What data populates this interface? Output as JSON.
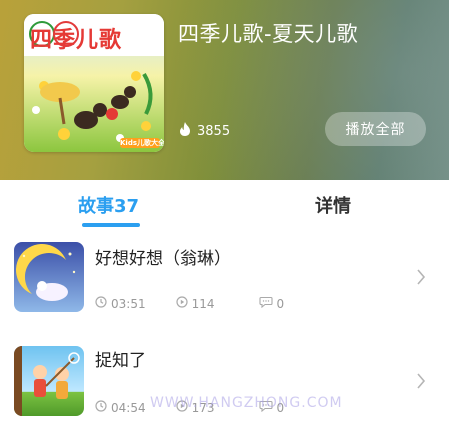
{
  "album": {
    "title": "四季儿歌-夏天儿歌",
    "play_count": "3855",
    "play_all_label": "播放全部",
    "cover_text": "四季儿歌",
    "cover_badge": "Kids儿歌大全"
  },
  "tabs": [
    {
      "label": "故事37",
      "active": true
    },
    {
      "label": "详情",
      "active": false
    }
  ],
  "stories": [
    {
      "title": "好想好想（翁琳）",
      "duration": "03:51",
      "plays": "114",
      "comments": "0"
    },
    {
      "title": "捉知了",
      "duration": "04:54",
      "plays": "173",
      "comments": "0"
    }
  ],
  "watermark": "WWW.HANGZHONG.COM",
  "colors": {
    "accent": "#2b9ff0",
    "meta": "#999999"
  },
  "icons": {
    "hot": "flame-icon",
    "duration": "clock-icon",
    "plays": "play-circle-icon",
    "comments": "comment-icon",
    "chevron": "chevron-right-icon"
  }
}
